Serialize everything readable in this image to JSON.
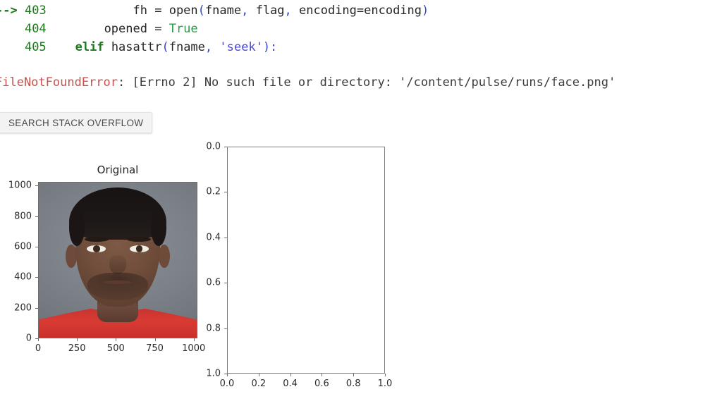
{
  "traceback": {
    "lines": [
      {
        "arrow": "-->",
        "number": "403",
        "indent": "            ",
        "code_plain_1": "fh = ",
        "code_fn": "open",
        "code_punc_1": "(",
        "code_plain_2": "fname",
        "code_punc_2": ",",
        "code_plain_3": " flag",
        "code_punc_3": ",",
        "code_plain_4": " encoding=encoding",
        "code_punc_4": ")"
      },
      {
        "arrow": "",
        "number": "404",
        "indent": "        ",
        "code_plain_1": "opened = ",
        "code_bool": "True"
      },
      {
        "arrow": "",
        "number": "405",
        "indent": "    ",
        "code_kw": "elif",
        "code_plain_1": " hasattr",
        "code_punc_1": "(",
        "code_plain_2": "fname",
        "code_punc_2": ",",
        "code_str": " 'seek'",
        "code_punc_3": "):"
      }
    ],
    "error": {
      "name": "FileNotFoundError",
      "message": ": [Errno 2] No such file or directory: '/content/pulse/runs/face.png'"
    }
  },
  "search_button": {
    "label": "SEARCH STACK OVERFLOW"
  },
  "chart_data": [
    {
      "type": "image",
      "title": "Original",
      "xlabel": "",
      "ylabel": "",
      "xticks": [
        "0",
        "250",
        "500",
        "750",
        "1000"
      ],
      "xtick_values": [
        0,
        250,
        500,
        750,
        1000
      ],
      "yticks": [
        "0",
        "200",
        "400",
        "600",
        "800",
        "1000"
      ],
      "ytick_values": [
        0,
        200,
        400,
        600,
        800,
        1000
      ],
      "xlim": [
        0,
        1024
      ],
      "ylim": [
        1024,
        0
      ],
      "grid": false,
      "legend": null,
      "description": "Portrait photograph of a person on a gray studio background wearing a red shirt"
    },
    {
      "type": "line",
      "title": "",
      "xlabel": "",
      "ylabel": "",
      "xticks": [
        "0.0",
        "0.2",
        "0.4",
        "0.6",
        "0.8",
        "1.0"
      ],
      "xtick_values": [
        0.0,
        0.2,
        0.4,
        0.6,
        0.8,
        1.0
      ],
      "yticks": [
        "0.0",
        "0.2",
        "0.4",
        "0.6",
        "0.8",
        "1.0"
      ],
      "ytick_values": [
        0.0,
        0.2,
        0.4,
        0.6,
        0.8,
        1.0
      ],
      "xlim": [
        0.0,
        1.0
      ],
      "ylim": [
        0.0,
        1.0
      ],
      "grid": false,
      "legend": null,
      "series": [],
      "description": "Empty axes with default 0.0 to 1.0 limits and no plotted data"
    }
  ]
}
